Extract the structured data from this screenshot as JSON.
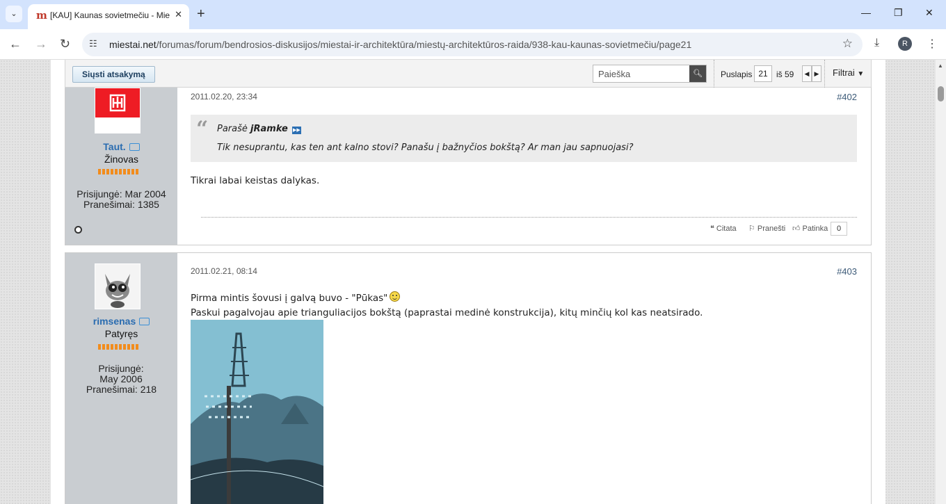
{
  "browser": {
    "tab_title": "[KAU] Kaunas sovietmečiu - Miestai.net",
    "url_host": "miestai.net",
    "url_path": "/forumas/forum/bendrosios-diskusijos/miestai-ir-architektūra/miestų-architektūros-raida/938-kau-kaunas-sovietmečiu/page21",
    "profile_initial": "R"
  },
  "toolbar": {
    "reply_label": "Siųsti atsakymą",
    "search_placeholder": "Paieška",
    "page_label": "Puslapis",
    "current_page": "21",
    "of_label": "iš 59",
    "filter_label": "Filtrai"
  },
  "posts": [
    {
      "username": "Taut.",
      "user_title": "Žinovas",
      "joined": "Prisijungė: Mar 2004",
      "posts_count": "Pranešimai: 1385",
      "date": "2011.02.20, 23:34",
      "number": "#402",
      "quote_prefix": "Parašė",
      "quote_author": "jRamke",
      "quote_text": "Tik nesuprantu, kas ten ant kalno stovi? Panašu į bažnyčios bokštą? Ar man jau sapnuojasi?",
      "body": "Tikrai labai keistas dalykas.",
      "actions": {
        "quote": "Citata",
        "report": "Pranešti",
        "like": "Patinka",
        "like_count": "0"
      }
    },
    {
      "username": "rimsenas",
      "user_title": "Patyręs",
      "joined": "Prisijungė: May 2006",
      "posts_count": "Pranešimai: 218",
      "date": "2011.02.21, 08:14",
      "number": "#403",
      "body_line1": "Pirma mintis šovusi į galvą buvo - \"Pūkas\"",
      "body_line2": "Paskui pagalvojau apie trianguliacijos bokštą (paprastai medinė konstrukcija), kitų minčių kol kas neatsirado."
    }
  ]
}
